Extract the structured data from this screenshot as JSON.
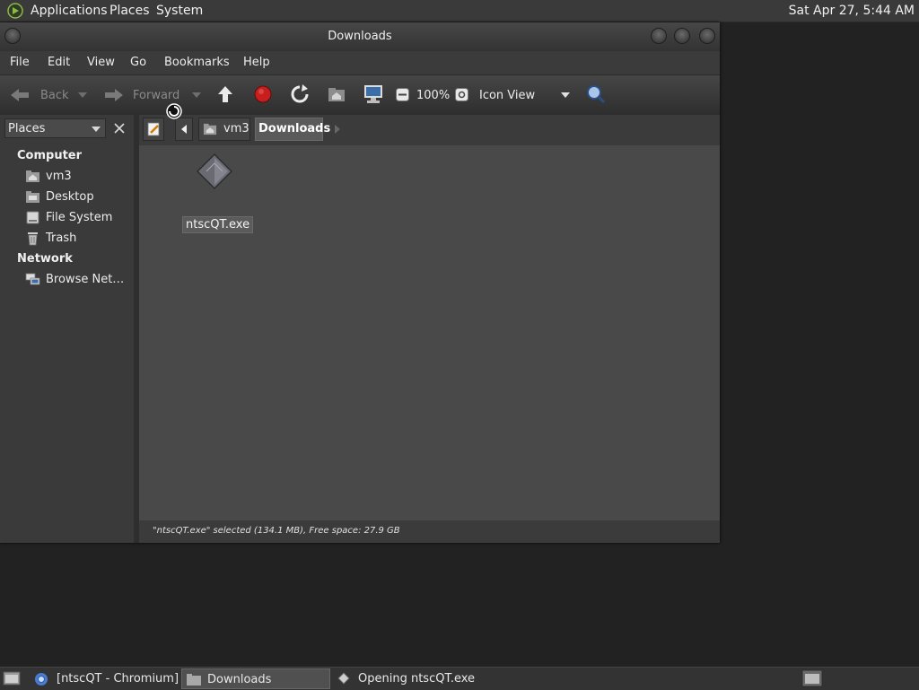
{
  "top_panel": {
    "menus": [
      "Applications",
      "Places",
      "System"
    ],
    "clock": "Sat Apr 27, 5:44 AM"
  },
  "window": {
    "title": "Downloads",
    "menubar": [
      "File",
      "Edit",
      "View",
      "Go",
      "Bookmarks",
      "Help"
    ],
    "toolbar": {
      "back_label": "Back",
      "forward_label": "Forward",
      "zoom_level": "100%",
      "view_mode": "Icon View"
    },
    "sidepane": {
      "selector": "Places",
      "sections": [
        {
          "heading": "Computer",
          "items": [
            {
              "label": "vm3",
              "icon": "home-folder-icon"
            },
            {
              "label": "Desktop",
              "icon": "desktop-folder-icon"
            },
            {
              "label": "File System",
              "icon": "drive-icon"
            },
            {
              "label": "Trash",
              "icon": "trash-icon"
            }
          ]
        },
        {
          "heading": "Network",
          "items": [
            {
              "label": "Browse Net…",
              "icon": "network-icon"
            }
          ]
        }
      ]
    },
    "location": {
      "crumbs": [
        "vm3",
        "Downloads"
      ]
    },
    "files": [
      {
        "name": "ntscQT.exe",
        "selected": true
      }
    ],
    "status": "\"ntscQT.exe\" selected (134.1 MB), Free space: 27.9 GB"
  },
  "taskbar": {
    "tasks": [
      {
        "label": "[ntscQT - Chromium]",
        "active": false
      },
      {
        "label": "Downloads",
        "active": true
      },
      {
        "label": "Opening ntscQT.exe",
        "active": false
      }
    ]
  },
  "colors": {
    "window_bg": "#3b3b3b",
    "content_bg": "#494949",
    "desktop_bg": "#212221",
    "stop_red": "#c81e1e"
  }
}
